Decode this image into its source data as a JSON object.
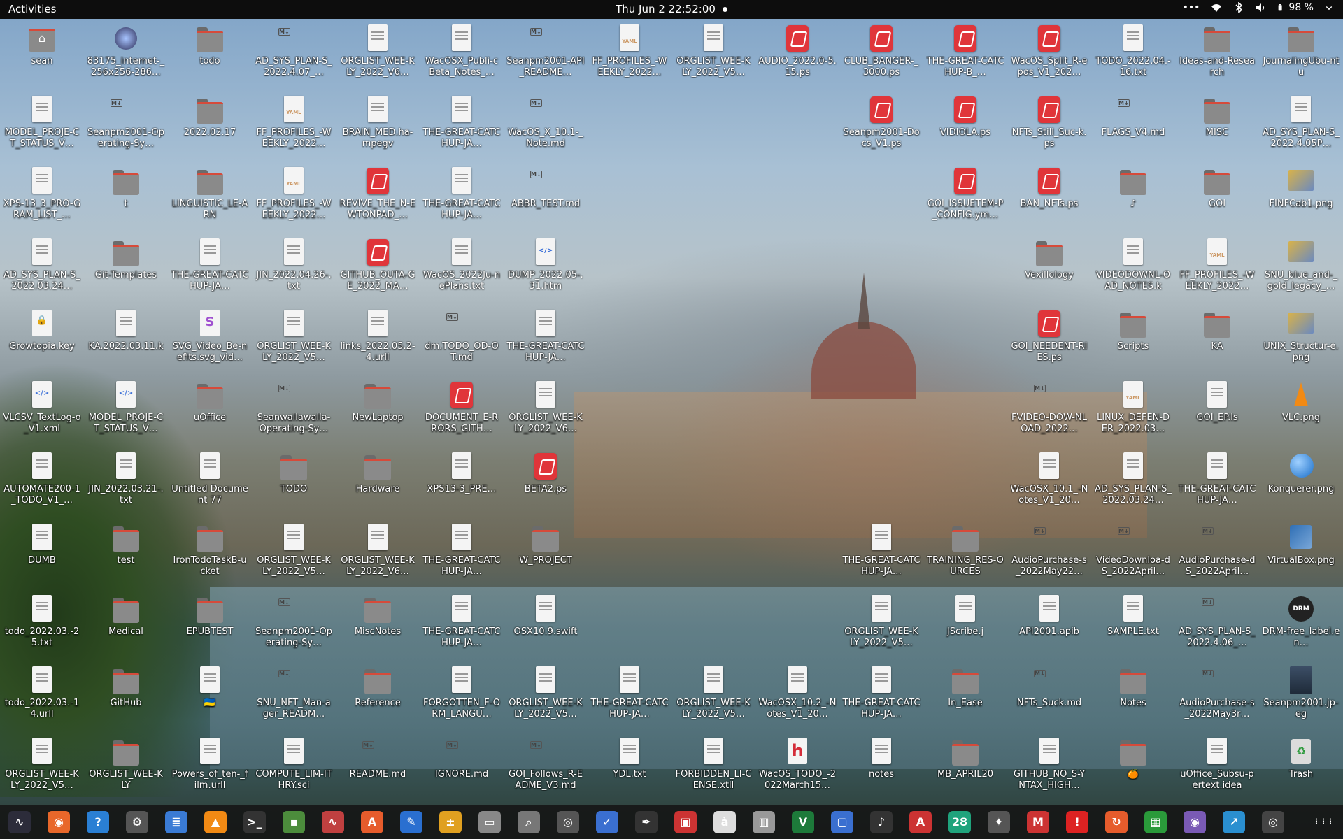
{
  "topbar": {
    "activities": "Activities",
    "clock": "Thu Jun 2  22:52:00",
    "battery": "98 %"
  },
  "desktop": {
    "icons": [
      {
        "label": "sean",
        "kind": "home"
      },
      {
        "label": "83175_internet-_256x256-286…",
        "kind": "app"
      },
      {
        "label": "todo",
        "kind": "folder"
      },
      {
        "label": "AD_SYS_PLAN-S_2022.4.07_…",
        "kind": "md"
      },
      {
        "label": "ORGLIST_WEE-KLY_2022_V6…",
        "kind": "doc"
      },
      {
        "label": "WacOSX_Publi-cBeta_Notes_…",
        "kind": "doc"
      },
      {
        "label": "Seanpm2001-API_README…",
        "kind": "md"
      },
      {
        "label": "FF_PROFILES_-WEEKLY_2022…",
        "kind": "yaml"
      },
      {
        "label": "ORGLIST_WEE-KLY_2022_V5…",
        "kind": "doc"
      },
      {
        "label": "AUDIO_2022.0-5.15.ps",
        "kind": "ps"
      },
      {
        "label": "CLUB_BANGER-_3000.ps",
        "kind": "ps"
      },
      {
        "label": "THE-GREAT-CATCHUP-B_…",
        "kind": "ps"
      },
      {
        "label": "WacOS_Split_R-epos_V1_202…",
        "kind": "ps"
      },
      {
        "label": "TODO_2022.04.-16.txt",
        "kind": "doc"
      },
      {
        "label": "Ideas-and-Research",
        "kind": "folder"
      },
      {
        "label": "JournalingUbu-ntu",
        "kind": "folder"
      },
      {
        "label": "MODEL_PROJE-CT_STATUS_V…",
        "kind": "doc"
      },
      {
        "label": "Seanpm2001-Operating-Sy…",
        "kind": "md"
      },
      {
        "label": "2022.02.17",
        "kind": "folder"
      },
      {
        "label": "FF_PROFILES_-WEEKLY_2022…",
        "kind": "yaml"
      },
      {
        "label": "BRAIN_MED.ha-mpegv",
        "kind": "doc"
      },
      {
        "label": "THE-GREAT-CATCHUP-JA…",
        "kind": "doc"
      },
      {
        "label": "WacOS_X_10.1-_Note.md",
        "kind": "md"
      },
      {
        "label": "",
        "kind": "empty"
      },
      {
        "label": "",
        "kind": "empty"
      },
      {
        "label": "",
        "kind": "empty"
      },
      {
        "label": "Seanpm2001-Docs_V1.ps",
        "kind": "ps"
      },
      {
        "label": "VIDIOLA.ps",
        "kind": "ps"
      },
      {
        "label": "NFTs_Still_Suc-k.ps",
        "kind": "ps"
      },
      {
        "label": "FLAGS_V4.md",
        "kind": "md"
      },
      {
        "label": "MISC",
        "kind": "folder"
      },
      {
        "label": "AD_SYS_PLAN-S_2022.4.05P…",
        "kind": "doc"
      },
      {
        "label": "XPS-13_3_PRO-GRAM_LIST_…",
        "kind": "doc"
      },
      {
        "label": "t",
        "kind": "folder"
      },
      {
        "label": "LINGUISTIC_LE-ARN",
        "kind": "folder"
      },
      {
        "label": "FF_PROFILES_-WEEKLY_2022…",
        "kind": "yaml"
      },
      {
        "label": "REVIVE_THE_N-EWTONPAD_…",
        "kind": "ps"
      },
      {
        "label": "THE-GREAT-CATCHUP-JA…",
        "kind": "doc"
      },
      {
        "label": "ABBR_TEST.md",
        "kind": "md"
      },
      {
        "label": "",
        "kind": "empty"
      },
      {
        "label": "",
        "kind": "empty"
      },
      {
        "label": "",
        "kind": "empty"
      },
      {
        "label": "",
        "kind": "empty"
      },
      {
        "label": "GOI_ISSUETEM-P_CONFIG.ym…",
        "kind": "ps"
      },
      {
        "label": "BAN_NFTs.ps",
        "kind": "ps"
      },
      {
        "label": "♪",
        "kind": "folder"
      },
      {
        "label": "GOI",
        "kind": "folder"
      },
      {
        "label": "FINFCab1.png",
        "kind": "img"
      },
      {
        "label": "AD_SYS_PLAN-S_2022.03.24…",
        "kind": "doc"
      },
      {
        "label": "Git-Templates",
        "kind": "folder"
      },
      {
        "label": "THE-GREAT-CATCHUP-JA…",
        "kind": "doc"
      },
      {
        "label": "JIN_2022.04.26-.txt",
        "kind": "doc"
      },
      {
        "label": "GITHUB_OUTA-GE_2022_MA…",
        "kind": "ps"
      },
      {
        "label": "WacOS_2022Ju-nePlans.txt",
        "kind": "doc"
      },
      {
        "label": "DUMP_2022.05-.31.htm",
        "kind": "code"
      },
      {
        "label": "",
        "kind": "empty"
      },
      {
        "label": "",
        "kind": "empty"
      },
      {
        "label": "",
        "kind": "empty"
      },
      {
        "label": "",
        "kind": "empty"
      },
      {
        "label": "",
        "kind": "empty"
      },
      {
        "label": "Vexillology",
        "kind": "folder"
      },
      {
        "label": "VIDEODOWNL-OAD_NOTES.k",
        "kind": "doc"
      },
      {
        "label": "FF_PROFILES_-WEEKLY_2022…",
        "kind": "yaml"
      },
      {
        "label": "SNU_blue_and-_gold_legacy_…",
        "kind": "img"
      },
      {
        "label": "Growtopia.key",
        "kind": "lock"
      },
      {
        "label": "KA.2022.03.11.k",
        "kind": "doc"
      },
      {
        "label": "SVG_Video_Be-nefits.svg_vid…",
        "kind": "svgf"
      },
      {
        "label": "ORGLIST_WEE-KLY_2022_V5…",
        "kind": "doc"
      },
      {
        "label": "links_2022.05.2-4.urll",
        "kind": "doc"
      },
      {
        "label": "dm.TODO_OD-OT.md",
        "kind": "md"
      },
      {
        "label": "THE-GREAT-CATCHUP-JA…",
        "kind": "doc"
      },
      {
        "label": "",
        "kind": "empty"
      },
      {
        "label": "",
        "kind": "empty"
      },
      {
        "label": "",
        "kind": "empty"
      },
      {
        "label": "",
        "kind": "empty"
      },
      {
        "label": "",
        "kind": "empty"
      },
      {
        "label": "GOI_NEEDENT-RIES.ps",
        "kind": "ps"
      },
      {
        "label": "Scripts",
        "kind": "folder"
      },
      {
        "label": "KA",
        "kind": "folder"
      },
      {
        "label": "UNIX_Structur-e.png",
        "kind": "img"
      },
      {
        "label": "VLCSV_TextLog-o_V1.xml",
        "kind": "code"
      },
      {
        "label": "MODEL_PROJE-CT_STATUS_V…",
        "kind": "code"
      },
      {
        "label": "uOffice",
        "kind": "folder"
      },
      {
        "label": "Seanwallawalla-Operating-Sy…",
        "kind": "md"
      },
      {
        "label": "NewLaptop",
        "kind": "folder"
      },
      {
        "label": "DOCUMENT_E-RRORS_GITH…",
        "kind": "ps"
      },
      {
        "label": "ORGLIST_WEE-KLY_2022_V6…",
        "kind": "doc"
      },
      {
        "label": "",
        "kind": "empty"
      },
      {
        "label": "",
        "kind": "empty"
      },
      {
        "label": "",
        "kind": "empty"
      },
      {
        "label": "",
        "kind": "empty"
      },
      {
        "label": "",
        "kind": "empty"
      },
      {
        "label": "FVIDEO-DOW-NLOAD_2022…",
        "kind": "md"
      },
      {
        "label": "LINUX_DEFEN-DER_2022.03…",
        "kind": "yaml"
      },
      {
        "label": "GOI_EP.ls",
        "kind": "doc"
      },
      {
        "label": "VLC.png",
        "kind": "vlc"
      },
      {
        "label": "AUTOMATE200-1_TODO_V1_…",
        "kind": "doc"
      },
      {
        "label": "JIN_2022.03.21-.txt",
        "kind": "doc"
      },
      {
        "label": "Untitled Document 77",
        "kind": "doc"
      },
      {
        "label": "TODO",
        "kind": "folder"
      },
      {
        "label": "Hardware",
        "kind": "folder"
      },
      {
        "label": "XPS13-3_PRE…",
        "kind": "doc"
      },
      {
        "label": "BETA2.ps",
        "kind": "ps"
      },
      {
        "label": "",
        "kind": "empty"
      },
      {
        "label": "",
        "kind": "empty"
      },
      {
        "label": "",
        "kind": "empty"
      },
      {
        "label": "",
        "kind": "empty"
      },
      {
        "label": "",
        "kind": "empty"
      },
      {
        "label": "WacOSX_10.1_-Notes_V1_20…",
        "kind": "doc"
      },
      {
        "label": "AD_SYS_PLAN-S_2022.03.24…",
        "kind": "doc"
      },
      {
        "label": "THE-GREAT-CATCHUP-JA…",
        "kind": "doc"
      },
      {
        "label": "Konquerer.png",
        "kind": "globe"
      },
      {
        "label": "DUMB",
        "kind": "doc"
      },
      {
        "label": "test",
        "kind": "folder"
      },
      {
        "label": "IronTodoTaskB-ucket",
        "kind": "folder"
      },
      {
        "label": "ORGLIST_WEE-KLY_2022_V5…",
        "kind": "doc"
      },
      {
        "label": "ORGLIST_WEE-KLY_2022_V6…",
        "kind": "doc"
      },
      {
        "label": "THE-GREAT-CATCHUP-JA…",
        "kind": "doc"
      },
      {
        "label": "W_PROJECT",
        "kind": "folder"
      },
      {
        "label": "",
        "kind": "empty"
      },
      {
        "label": "",
        "kind": "empty"
      },
      {
        "label": "",
        "kind": "empty"
      },
      {
        "label": "THE-GREAT-CATCHUP-JA…",
        "kind": "doc"
      },
      {
        "label": "TRAINING_RES-OURCES",
        "kind": "folder"
      },
      {
        "label": "AudioPurchase-s_2022May22…",
        "kind": "md"
      },
      {
        "label": "VideoDownloa-dS_2022April…",
        "kind": "md"
      },
      {
        "label": "AudioPurchase-dS_2022April…",
        "kind": "md"
      },
      {
        "label": "VirtualBox.png",
        "kind": "box"
      },
      {
        "label": "todo_2022.03.-25.txt",
        "kind": "doc"
      },
      {
        "label": "Medical",
        "kind": "folder"
      },
      {
        "label": "EPUBTEST",
        "kind": "folder"
      },
      {
        "label": "Seanpm2001-Operating-Sy…",
        "kind": "md"
      },
      {
        "label": "MiscNotes",
        "kind": "folder"
      },
      {
        "label": "THE-GREAT-CATCHUP-JA…",
        "kind": "doc"
      },
      {
        "label": "OSX10.9.swift",
        "kind": "doc"
      },
      {
        "label": "",
        "kind": "empty"
      },
      {
        "label": "",
        "kind": "empty"
      },
      {
        "label": "",
        "kind": "empty"
      },
      {
        "label": "ORGLIST_WEE-KLY_2022_V5…",
        "kind": "doc"
      },
      {
        "label": "JScribe.j",
        "kind": "doc"
      },
      {
        "label": "API2001.apib",
        "kind": "doc"
      },
      {
        "label": "SAMPLE.txt",
        "kind": "doc"
      },
      {
        "label": "AD_SYS_PLAN-S_2022.4.06_…",
        "kind": "md"
      },
      {
        "label": "DRM-free_label.en…",
        "kind": "drm"
      },
      {
        "label": "todo_2022.03.-14.urll",
        "kind": "doc"
      },
      {
        "label": "GitHub",
        "kind": "folder"
      },
      {
        "label": "🇺🇦",
        "kind": "doc"
      },
      {
        "label": "SNU_NFT_Man-ager_READM…",
        "kind": "md"
      },
      {
        "label": "Reference",
        "kind": "folder"
      },
      {
        "label": "FORGOTTEN_F-ORM_LANGU…",
        "kind": "doc"
      },
      {
        "label": "ORGLIST_WEE-KLY_2022_V5…",
        "kind": "doc"
      },
      {
        "label": "THE-GREAT-CATCHUP-JA…",
        "kind": "doc"
      },
      {
        "label": "ORGLIST_WEE-KLY_2022_V5…",
        "kind": "doc"
      },
      {
        "label": "WacOSX_10.2_-Notes_V1_20…",
        "kind": "doc"
      },
      {
        "label": "THE-GREAT-CATCHUP-JA…",
        "kind": "doc"
      },
      {
        "label": "In_Ease",
        "kind": "folder"
      },
      {
        "label": "NFTs_Suck.md",
        "kind": "md"
      },
      {
        "label": "Notes",
        "kind": "folder"
      },
      {
        "label": "AudioPurchase-s_2022May3r…",
        "kind": "md"
      },
      {
        "label": "Seanpm2001.jp-eg",
        "kind": "photo"
      },
      {
        "label": "ORGLIST_WEE-KLY_2022_V5…",
        "kind": "doc"
      },
      {
        "label": "ORGLIST_WEE-KLY",
        "kind": "folder"
      },
      {
        "label": "Powers_of_ten-_film.urll",
        "kind": "doc"
      },
      {
        "label": "COMPUTE_LIM-ITHRY.sci",
        "kind": "doc"
      },
      {
        "label": "README.md",
        "kind": "md"
      },
      {
        "label": "IGNORE.md",
        "kind": "md"
      },
      {
        "label": "GOI_Follows_R-EADME_V3.md",
        "kind": "md"
      },
      {
        "label": "YDL.txt",
        "kind": "doc"
      },
      {
        "label": "FORBIDDEN_LI-CENSE.xtll",
        "kind": "doc"
      },
      {
        "label": "WacOS_TODO_-2022March15…",
        "kind": "hfile"
      },
      {
        "label": "notes",
        "kind": "doc"
      },
      {
        "label": "MB_APRIL20",
        "kind": "folder"
      },
      {
        "label": "GITHUB_NO_S-YNTAX_HIGH…",
        "kind": "doc"
      },
      {
        "label": "🍊",
        "kind": "folder"
      },
      {
        "label": "uOffice_Subsu-pertext.idea",
        "kind": "doc"
      },
      {
        "label": "Trash",
        "kind": "trash"
      }
    ]
  },
  "dock": {
    "apps": [
      {
        "name": "system-monitor-icon",
        "glyph": "∿",
        "color": "#2c2c3a"
      },
      {
        "name": "firefox-icon",
        "glyph": "◉",
        "color": "#e8672a"
      },
      {
        "name": "help-icon",
        "glyph": "?",
        "color": "#2a7fd4"
      },
      {
        "name": "settings-icon",
        "glyph": "⚙",
        "color": "#555"
      },
      {
        "name": "document-viewer-icon",
        "glyph": "≣",
        "color": "#3a7bd5"
      },
      {
        "name": "vlc-icon",
        "glyph": "▲",
        "color": "#f28a14"
      },
      {
        "name": "terminal-icon",
        "glyph": ">_",
        "color": "#333"
      },
      {
        "name": "extension-icon",
        "glyph": "▪",
        "color": "#4c8c3c"
      },
      {
        "name": "graph-icon",
        "glyph": "∿",
        "color": "#c04040"
      },
      {
        "name": "software-center-icon",
        "glyph": "A",
        "color": "#e65c2c"
      },
      {
        "name": "text-editor-icon",
        "glyph": "✎",
        "color": "#2a6fd0"
      },
      {
        "name": "calculator-icon",
        "glyph": "±",
        "color": "#e0a020"
      },
      {
        "name": "files-icon",
        "glyph": "▭",
        "color": "#888"
      },
      {
        "name": "search-icon",
        "glyph": "⌕",
        "color": "#777"
      },
      {
        "name": "disk-icon",
        "glyph": "◎",
        "color": "#555"
      },
      {
        "name": "todo-icon",
        "glyph": "✓",
        "color": "#3a6fd0"
      },
      {
        "name": "inkscape-icon",
        "glyph": "✒",
        "color": "#333"
      },
      {
        "name": "screenshot-icon",
        "glyph": "▣",
        "color": "#c33"
      },
      {
        "name": "character-map-icon",
        "glyph": "à",
        "color": "#ddd"
      },
      {
        "name": "archive-icon",
        "glyph": "▥",
        "color": "#999"
      },
      {
        "name": "vim-icon",
        "glyph": "V",
        "color": "#1d7a3a"
      },
      {
        "name": "remote-desktop-icon",
        "glyph": "▢",
        "color": "#3a6fd0"
      },
      {
        "name": "music-icon",
        "glyph": "♪",
        "color": "#333"
      },
      {
        "name": "pdf-icon",
        "glyph": "A",
        "color": "#c33"
      },
      {
        "name": "calendar-icon",
        "glyph": "28",
        "color": "#1fa37c"
      },
      {
        "name": "game-icon",
        "glyph": "✦",
        "color": "#555"
      },
      {
        "name": "mario-icon",
        "glyph": "M",
        "color": "#c33"
      },
      {
        "name": "alert-icon",
        "glyph": "!",
        "color": "#d22"
      },
      {
        "name": "update-icon",
        "glyph": "↻",
        "color": "#e65c2c"
      },
      {
        "name": "spreadsheet-icon",
        "glyph": "▦",
        "color": "#2a9a3a"
      },
      {
        "name": "camera-icon",
        "glyph": "◉",
        "color": "#7a5ab5"
      },
      {
        "name": "chart-icon",
        "glyph": "↗",
        "color": "#2a8fd0"
      },
      {
        "name": "ubuntu-icon",
        "glyph": "◎",
        "color": "#444"
      }
    ],
    "show_apps_glyph": "⋮⋮⋮"
  }
}
